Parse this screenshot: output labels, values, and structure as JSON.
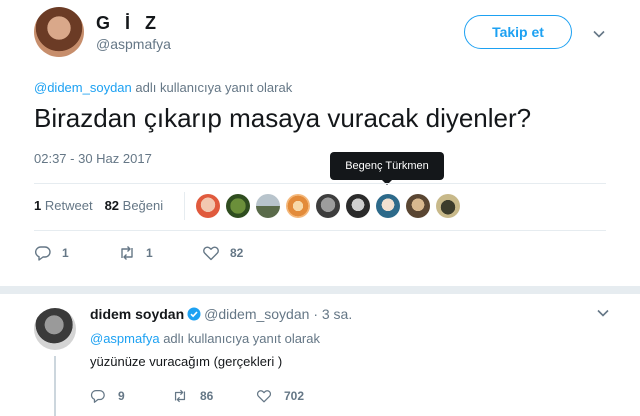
{
  "tweet": {
    "display_name": "G İ Z",
    "handle": "@aspmafya",
    "follow_label": "Takip et",
    "reply_mention": "@didem_soydan",
    "reply_suffix": "adlı kullanıcıya yanıt olarak",
    "text": "Birazdan çıkarıp masaya vuracak diyenler?",
    "timestamp": "02:37 - 30 Haz 2017",
    "tooltip": "Begenç Türkmen",
    "retweet_count": "1",
    "retweet_label": "Retweet",
    "like_count": "82",
    "like_label": "Beğeni",
    "actions": {
      "reply": "1",
      "retweet": "1",
      "like": "82"
    }
  },
  "reply": {
    "display_name": "didem soydan",
    "handle": "@didem_soydan",
    "time": "· 3 sa.",
    "reply_mention": "@aspmafya",
    "reply_suffix": "adlı kullanıcıya yanıt olarak",
    "text": "yüzünüze vuracağım (gerçekleri )",
    "actions": {
      "reply": "9",
      "retweet": "86",
      "like": "702"
    }
  },
  "colors": {
    "accent": "#1da1f2",
    "muted": "#657786",
    "text": "#14171a",
    "divider": "#e6ecf0"
  },
  "icons": [
    "chevron-down-icon",
    "reply-icon",
    "retweet-icon",
    "heart-icon",
    "verified-icon"
  ]
}
